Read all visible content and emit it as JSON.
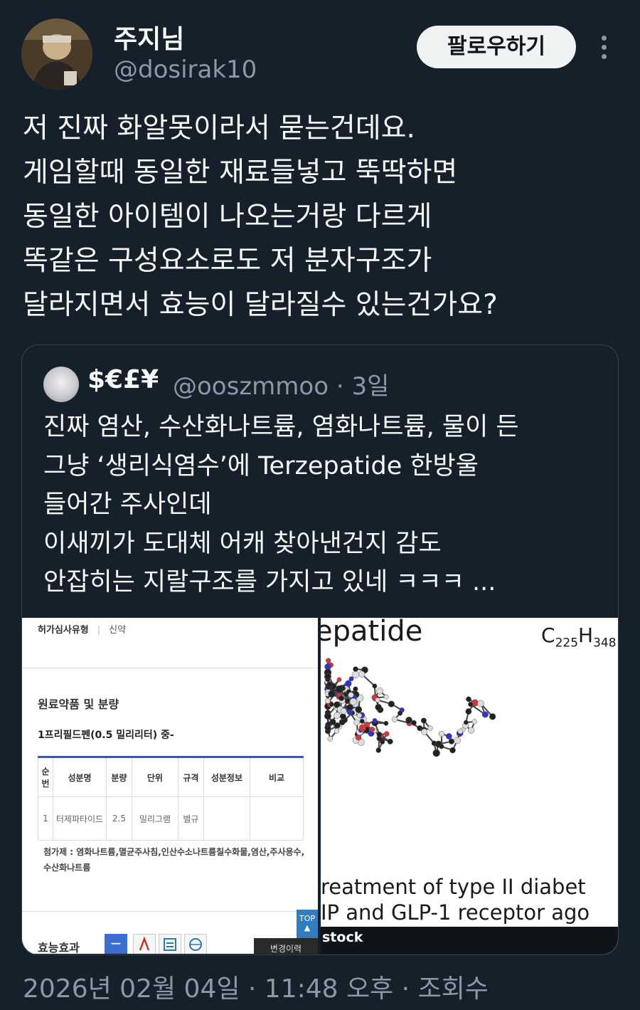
{
  "author": {
    "display_name": "주지님",
    "handle": "@dosirak10"
  },
  "actions": {
    "follow_label": "팔로우하기",
    "more_icon": "more-dots-icon"
  },
  "tweet": {
    "text": "저 진짜 화알못이라서 묻는건데요.\n게임할때 동일한 재료들넣고 뚝딱하면\n동일한 아이템이 나오는거랑 다르게\n똑같은 구성요소로도  저 분자구조가\n달라지면서 효능이 달라질수 있는건가요?",
    "timestamp": "2026년 02월 04일 · 11:48 오후 · 조회수"
  },
  "quoted_tweet": {
    "display_name": "$€£¥",
    "handle": "@ooszmmoo",
    "age": "3일",
    "text": "진짜 염산, 수산화나트륨, 염화나트륨, 물이 든\n그냥 ‘생리식염수’에 Terzepatide 한방울\n들어간 주사인데\n이새끼가 도대체 어캐 찾아낸건지 감도\n안잡히는 지랄구조를 가지고 있네 ㅋㅋㅋ ..."
  },
  "left_image": {
    "review_type_label": "허가심사유형",
    "review_type_value": "신약",
    "section_title": "원료약품 및 분량",
    "subtitle": "1프리필드펜(0.5 밀리리터) 중-",
    "table_headers": [
      "순번",
      "성분명",
      "분량",
      "단위",
      "규격",
      "성분정보",
      "비교"
    ],
    "table_rows": [
      [
        "1",
        "터제파타이드",
        "2.5",
        "밀리그램",
        "별규",
        "",
        ""
      ]
    ],
    "additives": "첨가제 : 염화나트륨,멸균주사침,인산수소나트륨칠수화물,염산,주사용수,수산화나트륨",
    "efficacy_label": "효능효과",
    "top_label": "TOP",
    "history_label": "변경이력"
  },
  "right_image": {
    "title_fragment": "epatide",
    "formula": {
      "c": "C",
      "c_sub": "225",
      "h": "H",
      "h_sub": "348"
    },
    "caption_line1": "reatment of type II diabet",
    "caption_line2": "IP and GLP-1 receptor ago",
    "watermark": "stock"
  }
}
